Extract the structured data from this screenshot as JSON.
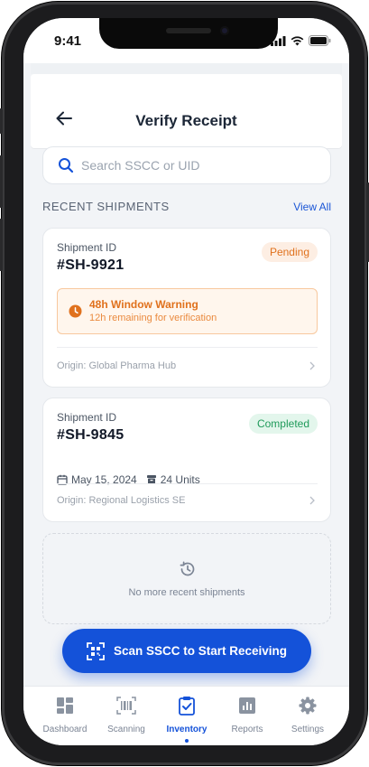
{
  "status_bar": {
    "time": "9:41"
  },
  "header": {
    "title": "Verify Receipt"
  },
  "search": {
    "placeholder": "Search SSCC or UID"
  },
  "recent": {
    "section_title": "RECENT SHIPMENTS",
    "view_all": "View All"
  },
  "shipments": [
    {
      "label": "Shipment ID",
      "id": "#SH-9921",
      "status": "Pending",
      "warning_title": "48h Window Warning",
      "warning_sub": "12h remaining for verification",
      "origin": "Origin: Global Pharma Hub"
    },
    {
      "label": "Shipment ID",
      "id": "#SH-9845",
      "status": "Completed",
      "date": "May 15, 2024",
      "units": "24 Units",
      "origin": "Origin: Regional Logistics SE"
    }
  ],
  "empty_state": {
    "text": "No more recent shipments"
  },
  "cta": {
    "label": "Scan SSCC to Start Receiving"
  },
  "tabs": [
    {
      "label": "Dashboard",
      "icon": "dashboard-icon"
    },
    {
      "label": "Scanning",
      "icon": "barcode-icon"
    },
    {
      "label": "Inventory",
      "icon": "clipboard-check-icon",
      "active": true
    },
    {
      "label": "Reports",
      "icon": "chart-icon"
    },
    {
      "label": "Settings",
      "icon": "gear-icon"
    }
  ],
  "colors": {
    "primary": "#1452d9",
    "pending": "#e0711d",
    "completed": "#1f9a5a"
  }
}
